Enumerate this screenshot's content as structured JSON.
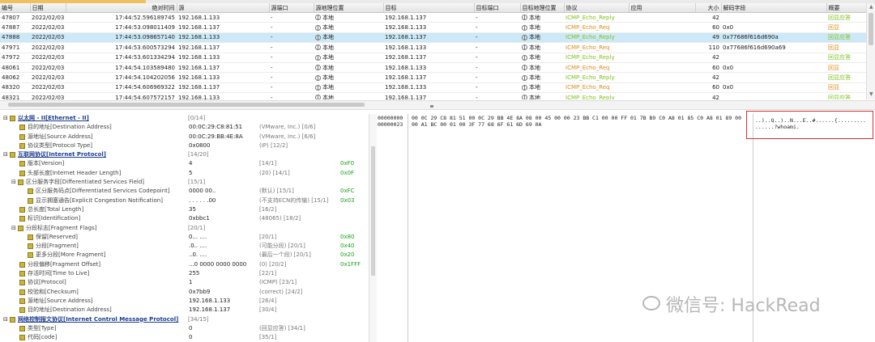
{
  "packet_list": {
    "columns": [
      "编号",
      "日期",
      "绝对时间",
      "源",
      "源端口",
      "源地理位置",
      "目标",
      "目标端口",
      "目标地理位置",
      "协议",
      "应用",
      "大小",
      "解码字段",
      "概要"
    ],
    "rows": [
      {
        "no": "47807",
        "date": "2022/02/03",
        "time": "17:44:52.596189745",
        "src": "192.168.1.133",
        "sport": "-",
        "sloc": "本地",
        "dst": "192.168.1.137",
        "dport": "-",
        "dloc": "本地",
        "proto": "ICMP_Echo_Reply",
        "app": "",
        "size": "42",
        "decode": "",
        "summary": "回显应答"
      },
      {
        "no": "47887",
        "date": "2022/02/03",
        "time": "17:44:53.098011409",
        "src": "192.168.1.137",
        "sport": "-",
        "sloc": "本地",
        "dst": "192.168.1.133",
        "dport": "-",
        "dloc": "本地",
        "proto": "ICMP_Echo_Req",
        "app": "",
        "size": "60",
        "decode": "0x0",
        "summary": "回显"
      },
      {
        "no": "47888",
        "date": "2022/02/03",
        "time": "17:44:53.098657140",
        "src": "192.168.1.133",
        "sport": "-",
        "sloc": "本地",
        "dst": "192.168.1.137",
        "dport": "-",
        "dloc": "本地",
        "proto": "ICMP_Echo_Reply",
        "app": "",
        "size": "49",
        "decode": "0x77686f616d690a",
        "summary": "回显应答"
      },
      {
        "no": "47971",
        "date": "2022/02/03",
        "time": "17:44:53.600573294",
        "src": "192.168.1.137",
        "sport": "-",
        "sloc": "本地",
        "dst": "192.168.1.133",
        "dport": "-",
        "dloc": "本地",
        "proto": "ICMP_Echo_Req",
        "app": "",
        "size": "110",
        "decode": "0x77686f616d690a69",
        "summary": "回显"
      },
      {
        "no": "47972",
        "date": "2022/02/03",
        "time": "17:44:53.601334294",
        "src": "192.168.1.133",
        "sport": "-",
        "sloc": "本地",
        "dst": "192.168.1.137",
        "dport": "-",
        "dloc": "本地",
        "proto": "ICMP_Echo_Reply",
        "app": "",
        "size": "42",
        "decode": "",
        "summary": "回显应答"
      },
      {
        "no": "48061",
        "date": "2022/02/03",
        "time": "17:44:54.103589480",
        "src": "192.168.1.137",
        "sport": "-",
        "sloc": "本地",
        "dst": "192.168.1.133",
        "dport": "-",
        "dloc": "本地",
        "proto": "ICMP_Echo_Req",
        "app": "",
        "size": "60",
        "decode": "0x0",
        "summary": "回显"
      },
      {
        "no": "48062",
        "date": "2022/02/03",
        "time": "17:44:54.104202056",
        "src": "192.168.1.133",
        "sport": "-",
        "sloc": "本地",
        "dst": "192.168.1.137",
        "dport": "-",
        "dloc": "本地",
        "proto": "ICMP_Echo_Reply",
        "app": "",
        "size": "42",
        "decode": "",
        "summary": "回显应答"
      },
      {
        "no": "48320",
        "date": "2022/02/03",
        "time": "17:44:54.606969322",
        "src": "192.168.1.137",
        "sport": "-",
        "sloc": "本地",
        "dst": "192.168.1.133",
        "dport": "-",
        "dloc": "本地",
        "proto": "ICMP_Echo_Req",
        "app": "",
        "size": "60",
        "decode": "0x0",
        "summary": "回显"
      },
      {
        "no": "48321",
        "date": "2022/02/03",
        "time": "17:44:54.607572157",
        "src": "192.168.1.133",
        "sport": "-",
        "sloc": "本地",
        "dst": "192.168.1.137",
        "dport": "-",
        "dloc": "本地",
        "proto": "ICMP_Echo_Reply",
        "app": "",
        "size": "42",
        "decode": "",
        "summary": "回显应答"
      }
    ]
  },
  "decode_tree": [
    {
      "indent": 0,
      "expand": "⊟",
      "hdr": true,
      "name": "以太网 - II[Ethernet - II]",
      "len": "[0/14]",
      "value": "",
      "desc": "",
      "extra": ""
    },
    {
      "indent": 1,
      "name": "目的地址[Destination Address]",
      "len": "",
      "value": "00:0C:29:C8:81:51",
      "desc": "(VMware, Inc.)  [0/6]",
      "extra": ""
    },
    {
      "indent": 1,
      "name": "源地址[Source Address]",
      "len": "",
      "value": "00:0C:29:BB:4E:8A",
      "desc": "(VMware, Inc.)  [6/6]",
      "extra": ""
    },
    {
      "indent": 1,
      "name": "协议类型[Protocol Type]",
      "len": "",
      "value": "0x0800",
      "desc": "(IP)  [12/2]",
      "extra": ""
    },
    {
      "indent": 0,
      "expand": "⊟",
      "hdr": true,
      "name": "互联网协议[Internet Protocol]",
      "len": "[14/20]",
      "value": "",
      "desc": "",
      "extra": ""
    },
    {
      "indent": 1,
      "name": "版本[Version]",
      "len": "",
      "value": "4",
      "desc": "[14/1]",
      "extra": "0xF0"
    },
    {
      "indent": 1,
      "name": "头部长度[Internet Header Length]",
      "len": "",
      "value": "5",
      "desc": "(20)  [14/1]",
      "extra": "0x0F"
    },
    {
      "indent": 1,
      "expand": "⊟",
      "name": "区分服务字段[Differentiated Services Field]",
      "len": "[15/1]",
      "value": "",
      "desc": "",
      "extra": ""
    },
    {
      "indent": 2,
      "name": "区分服务码点[Differentiated Services Codepoint]",
      "len": "",
      "value": "0000 00..",
      "desc": "(默认)  [15/1]",
      "extra": "0xFC"
    },
    {
      "indent": 2,
      "name": "显示拥塞通告[Explicit Congestion Notification]",
      "len": "",
      "value": ". . . . . .00",
      "desc": "(不支持ECN的传输)  [15/1]",
      "extra": "0x03"
    },
    {
      "indent": 1,
      "name": "总长度[Total Length]",
      "len": "",
      "value": "35",
      "desc": "[16/2]",
      "extra": ""
    },
    {
      "indent": 1,
      "name": "标识[Identification]",
      "len": "",
      "value": "0xbbc1",
      "desc": "(48065)  [18/2]",
      "extra": ""
    },
    {
      "indent": 1,
      "expand": "⊟",
      "name": "分段标志[Fragment Flags]",
      "len": "[20/1]",
      "value": "",
      "desc": "",
      "extra": ""
    },
    {
      "indent": 2,
      "name": "保留[Reserved]",
      "len": "",
      "value": "0... ....",
      "desc": "[20/1]",
      "extra": "0x80"
    },
    {
      "indent": 2,
      "name": "分段[Fragment]",
      "len": "",
      "value": ".0.. ....",
      "desc": "(可能分段)  [20/1]",
      "extra": "0x40"
    },
    {
      "indent": 2,
      "name": "更多分段[More Fragment]",
      "len": "",
      "value": "..0. ....",
      "desc": "(最后一个段)  [20/1]",
      "extra": "0x20"
    },
    {
      "indent": 1,
      "name": "分段偏移[Fragment Offset]",
      "len": "",
      "value": "...0 0000 0000 0000",
      "desc": "(0)  [20/2]",
      "extra": "0x1FFF"
    },
    {
      "indent": 1,
      "name": "存活时间[Time to Live]",
      "len": "",
      "value": "255",
      "desc": "[22/1]",
      "extra": ""
    },
    {
      "indent": 1,
      "name": "协议[Protocol]",
      "len": "",
      "value": "1",
      "desc": "(ICMP)  [23/1]",
      "extra": ""
    },
    {
      "indent": 1,
      "name": "校验和[Checksum]",
      "len": "",
      "value": "0x7bb9",
      "desc": "(correct)  [24/2]",
      "extra": ""
    },
    {
      "indent": 1,
      "name": "源地址[Source Address]",
      "len": "",
      "value": "192.168.1.133",
      "desc": "[26/4]",
      "extra": ""
    },
    {
      "indent": 1,
      "name": "目的地址[Destination Address]",
      "len": "",
      "value": "192.168.1.137",
      "desc": "[30/4]",
      "extra": ""
    },
    {
      "indent": 0,
      "expand": "⊟",
      "hdr": true,
      "name": "网络控制报文协议[Internet Control Message Protocol]",
      "len": "[34/15]",
      "value": "",
      "desc": "",
      "extra": ""
    },
    {
      "indent": 1,
      "name": "类型[Type]",
      "len": "",
      "value": "0",
      "desc": "(回显应答)  [34/1]",
      "extra": ""
    },
    {
      "indent": 1,
      "name": "代码[code]",
      "len": "",
      "value": "0",
      "desc": "[35/1]",
      "extra": ""
    }
  ],
  "hex_view": {
    "offsets": [
      "00000000",
      "00000023"
    ],
    "bytes": [
      "00 0C 29 C8 81 51 00 0C 29 BB 4E 8A 08 00 45 00 00 23 BB C1 00 00 FF 01 7B B9 C0 A8 01 85 C0 A8 01 89 00",
      "00 A1 BC 00 01 00 3F 77 68 6F 61 6D 69 0A"
    ],
    "ascii": [
      "..)..Q..)..N...E..#......{.........",
      "......?whoami."
    ]
  },
  "watermark": {
    "text": "微信号: HackRead"
  }
}
